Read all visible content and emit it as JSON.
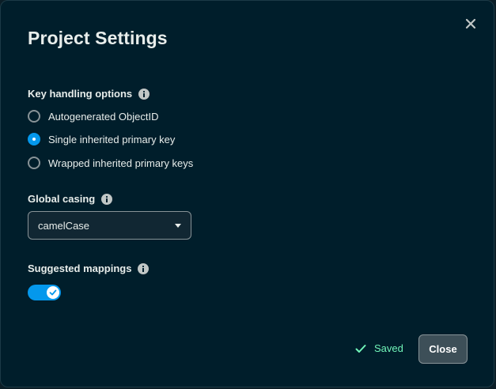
{
  "dialog": {
    "title": "Project Settings",
    "close_icon": "close-icon"
  },
  "key_handling": {
    "label": "Key handling options",
    "info_icon": "info-icon",
    "options": [
      {
        "label": "Autogenerated ObjectID",
        "selected": false
      },
      {
        "label": "Single inherited primary key",
        "selected": true
      },
      {
        "label": "Wrapped inherited primary keys",
        "selected": false
      }
    ]
  },
  "global_casing": {
    "label": "Global casing",
    "info_icon": "info-icon",
    "value": "camelCase",
    "caret_icon": "caret-down-icon"
  },
  "suggested_mappings": {
    "label": "Suggested mappings",
    "info_icon": "info-icon",
    "enabled": true
  },
  "footer": {
    "saved_label": "Saved",
    "saved_icon": "check-icon",
    "close_label": "Close"
  },
  "colors": {
    "background": "#001e2b",
    "accent": "#0498ec",
    "saved_green": "#71f6ba",
    "text": "#e8edeb"
  }
}
